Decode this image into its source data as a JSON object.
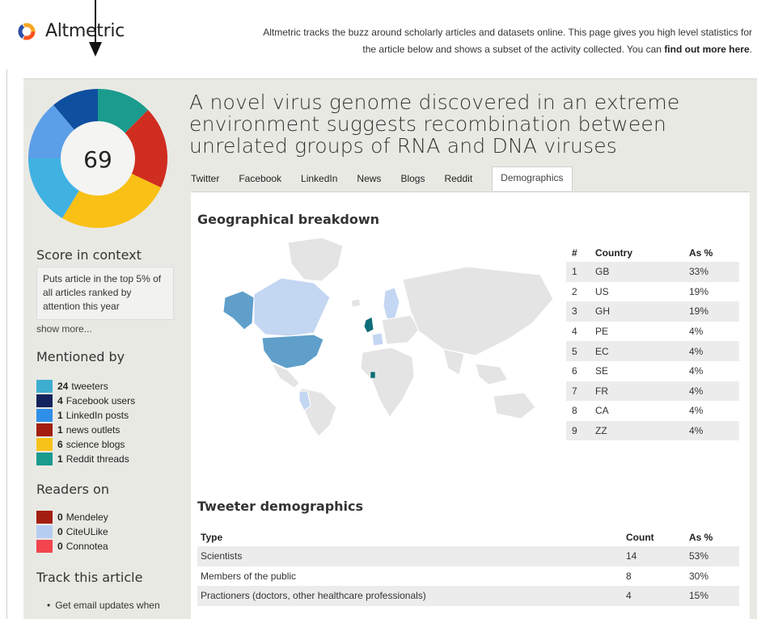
{
  "header": {
    "brand": "Altmetric",
    "intro_text": "Altmetric tracks the buzz around scholarly articles and datasets online. This page gives you high level statistics for the article below and shows a subset of the activity collected. You can",
    "intro_link": "find out more here",
    "intro_end": "."
  },
  "score": "69",
  "article": {
    "title": "A novel virus genome discovered in an extreme environment suggests recombination between unrelated groups of RNA and DNA viruses"
  },
  "tabs": [
    "Twitter",
    "Facebook",
    "LinkedIn",
    "News",
    "Blogs",
    "Reddit",
    "Demographics"
  ],
  "active_tab": "Demographics",
  "sidebar": {
    "score_heading": "Score in context",
    "score_context": "Puts article in the top 5% of all articles ranked by attention this year",
    "show_more": "show more...",
    "mentioned_heading": "Mentioned by",
    "mentioned": [
      {
        "count": "24",
        "label": "tweeters",
        "color": "#3eaed0"
      },
      {
        "count": "4",
        "label": "Facebook users",
        "color": "#13245d"
      },
      {
        "count": "1",
        "label": "LinkedIn posts",
        "color": "#2f8fe8"
      },
      {
        "count": "1",
        "label": "news outlets",
        "color": "#a31e10"
      },
      {
        "count": "6",
        "label": "science blogs",
        "color": "#f7c319"
      },
      {
        "count": "1",
        "label": "Reddit threads",
        "color": "#1a9b8e"
      }
    ],
    "readers_heading": "Readers on",
    "readers": [
      {
        "count": "0",
        "label": "Mendeley",
        "color": "#a31e10"
      },
      {
        "count": "0",
        "label": "CiteULike",
        "color": "#b6cdf2"
      },
      {
        "count": "0",
        "label": "Connotea",
        "color": "#f2454e"
      }
    ],
    "track_heading": "Track this article",
    "track_item": "Get email updates when"
  },
  "geo": {
    "heading": "Geographical breakdown",
    "columns": [
      "#",
      "Country",
      "As %"
    ],
    "rows": [
      [
        "1",
        "GB",
        "33%"
      ],
      [
        "2",
        "US",
        "19%"
      ],
      [
        "3",
        "GH",
        "19%"
      ],
      [
        "4",
        "PE",
        "4%"
      ],
      [
        "5",
        "EC",
        "4%"
      ],
      [
        "6",
        "SE",
        "4%"
      ],
      [
        "7",
        "FR",
        "4%"
      ],
      [
        "8",
        "CA",
        "4%"
      ],
      [
        "9",
        "ZZ",
        "4%"
      ]
    ]
  },
  "demographics": {
    "heading": "Tweeter demographics",
    "columns": [
      "Type",
      "Count",
      "As %"
    ],
    "rows": [
      [
        "Scientists",
        "14",
        "53%"
      ],
      [
        "Members of the public",
        "8",
        "30%"
      ],
      [
        "Practioners (doctors, other healthcare professionals)",
        "4",
        "15%"
      ]
    ]
  },
  "colors": {
    "map_high": "#0f6d77",
    "map_mid": "#5f9fca",
    "map_low": "#c3d6f2",
    "map_none": "#e4e4e4"
  }
}
